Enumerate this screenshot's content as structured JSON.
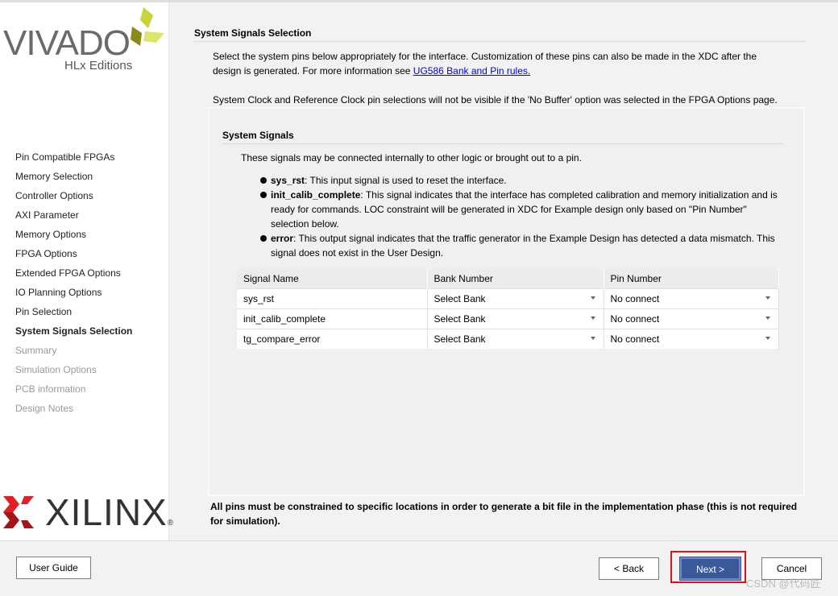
{
  "logo": {
    "product": "VIVADO",
    "edition": "HLx Editions",
    "company": "XILINX"
  },
  "sidebar": {
    "items": [
      {
        "label": "Pin Compatible FPGAs",
        "state": "normal"
      },
      {
        "label": "Memory Selection",
        "state": "normal"
      },
      {
        "label": "Controller Options",
        "state": "normal"
      },
      {
        "label": "AXI Parameter",
        "state": "normal"
      },
      {
        "label": "Memory Options",
        "state": "normal"
      },
      {
        "label": "FPGA Options",
        "state": "normal"
      },
      {
        "label": "Extended FPGA Options",
        "state": "normal"
      },
      {
        "label": "IO Planning Options",
        "state": "normal"
      },
      {
        "label": "Pin Selection",
        "state": "normal"
      },
      {
        "label": "System Signals Selection",
        "state": "active"
      },
      {
        "label": "Summary",
        "state": "disabled"
      },
      {
        "label": "Simulation Options",
        "state": "disabled"
      },
      {
        "label": "PCB information",
        "state": "disabled"
      },
      {
        "label": "Design Notes",
        "state": "disabled"
      }
    ]
  },
  "main": {
    "title": "System Signals Selection",
    "intro1": "Select the system pins below appropriately for the interface. Customization of these pins can also be made in the XDC after the",
    "intro2": "design is generated. For more information see ",
    "link": "UG586 Bank and Pin rules.",
    "clock_note": "System Clock and Reference Clock pin selections will not be visible if the 'No Buffer' option was selected in the FPGA Options page.",
    "panel": {
      "title": "System Signals",
      "desc": "These signals may be connected internally to other logic or brought out to a pin.",
      "bullets": [
        {
          "name": "sys_rst",
          "text": ": This input signal is used to reset the interface."
        },
        {
          "name": "init_calib_complete",
          "text": ": This signal indicates that the interface has completed calibration and memory initialization and is ready for commands. LOC constraint will be generated in XDC for Example design only based on \"Pin Number\" selection below."
        },
        {
          "name": "error",
          "text": ": This output signal indicates that the traffic generator in the Example Design has detected a data mismatch. This signal does not exist in the User Design."
        }
      ],
      "table": {
        "headers": [
          "Signal Name",
          "Bank Number",
          "Pin Number"
        ],
        "rows": [
          [
            "sys_rst",
            "Select Bank",
            "No connect"
          ],
          [
            "init_calib_complete",
            "Select Bank",
            "No connect"
          ],
          [
            "tg_compare_error",
            "Select Bank",
            "No connect"
          ]
        ]
      }
    },
    "note": "All pins must be constrained to specific locations in order to generate a bit file in the implementation phase (this is not required for simulation)."
  },
  "buttons": {
    "user_guide": "User Guide",
    "back": "< Back",
    "next": "Next >",
    "cancel": "Cancel"
  },
  "watermark": "CSDN @代码匠",
  "colors": {
    "accent": "#3b5998",
    "highlight": "#e0101c"
  }
}
